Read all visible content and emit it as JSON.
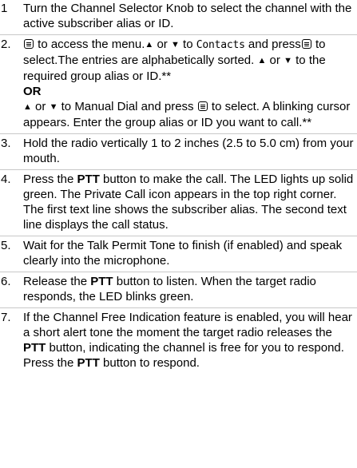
{
  "steps": [
    {
      "number": "1",
      "text": "Turn the Channel Selector Knob to select the channel with the active subscriber alias or ID."
    },
    {
      "number": "2.",
      "seg": {
        "a": " to access the menu.",
        "b": " or ",
        "c": " to ",
        "menu_item": "Contacts",
        "d": " and press",
        "e": " to select.The entries are alphabetically sorted. ",
        "f": " or ",
        "g": " to the required group alias or ID.**",
        "or": "OR",
        "h": " or ",
        "i": " to Manual Dial and press ",
        "j": " to select. A blinking cursor appears. Enter the group alias or ID you want to call.**"
      }
    },
    {
      "number": "3.",
      "text": "Hold the radio vertically 1 to 2 inches (2.5 to 5.0 cm) from your mouth."
    },
    {
      "number": "4.",
      "seg": {
        "a": "Press the ",
        "ptt": "PTT",
        "b": " button to make the call. The LED lights up solid green. The Private Call icon appears in the top right corner. The first text line shows the subscriber alias. The second text line displays the call status."
      }
    },
    {
      "number": "5.",
      "text": "Wait for the Talk Permit Tone to finish (if enabled) and speak clearly into the microphone."
    },
    {
      "number": "6.",
      "seg": {
        "a": "Release the ",
        "ptt": "PTT",
        "b": " button to listen. When the target radio responds, the LED blinks green."
      }
    },
    {
      "number": "7.",
      "seg": {
        "a": "If the Channel Free Indication feature is enabled, you will hear a short alert tone the moment the target radio releases the ",
        "ptt1": "PTT",
        "b": " button, indicating the channel is free for you to respond. Press the ",
        "ptt2": "PTT",
        "c": " button to respond."
      }
    }
  ],
  "icons": {
    "up_arrow": "▲",
    "down_arrow": "▼",
    "menu_ok_button": "menu-ok-button-icon"
  }
}
